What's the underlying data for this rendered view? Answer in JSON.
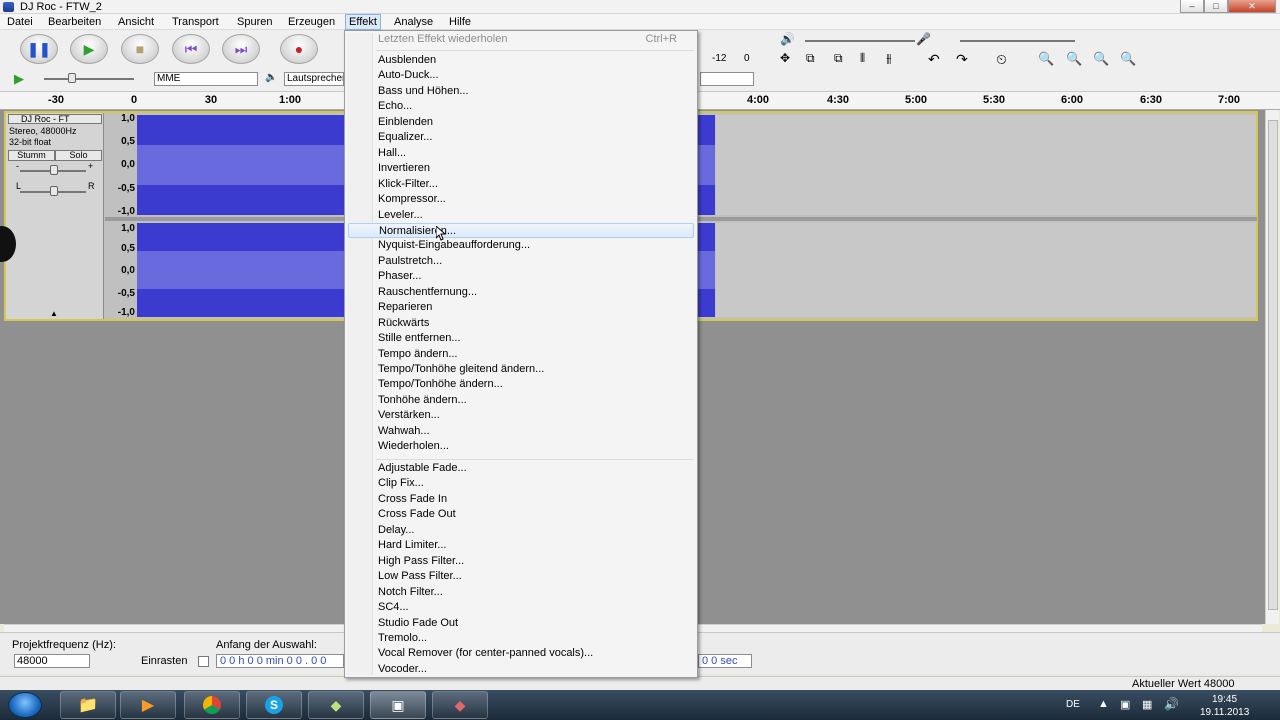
{
  "window": {
    "title": "DJ Roc - FTW_2",
    "min": "–",
    "max": "□",
    "close": "✕"
  },
  "menubar": [
    "Datei",
    "Bearbeiten",
    "Ansicht",
    "Transport",
    "Spuren",
    "Erzeugen",
    "Effekt",
    "Analyse",
    "Hilfe"
  ],
  "menu_active": "Effekt",
  "toolbar": {
    "host": "MME",
    "output": "Lautsprecher",
    "meter_labels": [
      "-12",
      "0"
    ]
  },
  "ruler": [
    "-30",
    "0",
    "30",
    "1:00",
    "4:00",
    "4:30",
    "5:00",
    "5:30",
    "6:00",
    "6:30",
    "7:00"
  ],
  "track": {
    "name": "DJ Roc - FT",
    "format": "Stereo, 48000Hz",
    "bits": "32-bit float",
    "mute": "Stumm",
    "solo": "Solo",
    "pan_left": "L",
    "pan_right": "R",
    "gain_minus": "-",
    "gain_plus": "+",
    "scale": [
      "1,0",
      "0,5",
      "0,0",
      "-0,5",
      "-1,0"
    ]
  },
  "effect_menu": {
    "repeat": {
      "label": "Letzten Effekt wiederholen",
      "shortcut": "Ctrl+R"
    },
    "group1": [
      "Ausblenden",
      "Auto-Duck...",
      "Bass und Höhen...",
      "Echo...",
      "Einblenden",
      "Equalizer...",
      "Hall...",
      "Invertieren",
      "Klick-Filter...",
      "Kompressor...",
      "Leveler...",
      "Normalisieren...",
      "Nyquist-Eingabeaufforderung...",
      "Paulstretch...",
      "Phaser...",
      "Rauschentfernung...",
      "Reparieren",
      "Rückwärts",
      "Stille entfernen...",
      "Tempo ändern...",
      "Tempo/Tonhöhe gleitend ändern...",
      "Tempo/Tonhöhe ändern...",
      "Tonhöhe ändern...",
      "Verstärken...",
      "Wahwah...",
      "Wiederholen..."
    ],
    "group2": [
      "Adjustable Fade...",
      "Clip Fix...",
      "Cross Fade In",
      "Cross Fade Out",
      "Delay...",
      "Hard Limiter...",
      "High Pass Filter...",
      "Low Pass Filter...",
      "Notch Filter...",
      "SC4...",
      "Studio Fade Out",
      "Tremolo...",
      "Vocal Remover (for center-panned vocals)...",
      "Vocoder..."
    ],
    "highlighted": "Normalisieren..."
  },
  "bottom": {
    "project_rate_label": "Projektfrequenz (Hz):",
    "project_rate": "48000",
    "snap_label": "Einrasten",
    "selection_label": "Anfang der Auswahl:",
    "selection_start": "0 0 h 0 0 min 0 0 . 0 0",
    "selection_end": "0 0 sec"
  },
  "status": {
    "value": "Aktueller Wert 48000"
  },
  "taskbar": {
    "lang": "DE",
    "time": "19:45",
    "date": "19.11.2013"
  }
}
